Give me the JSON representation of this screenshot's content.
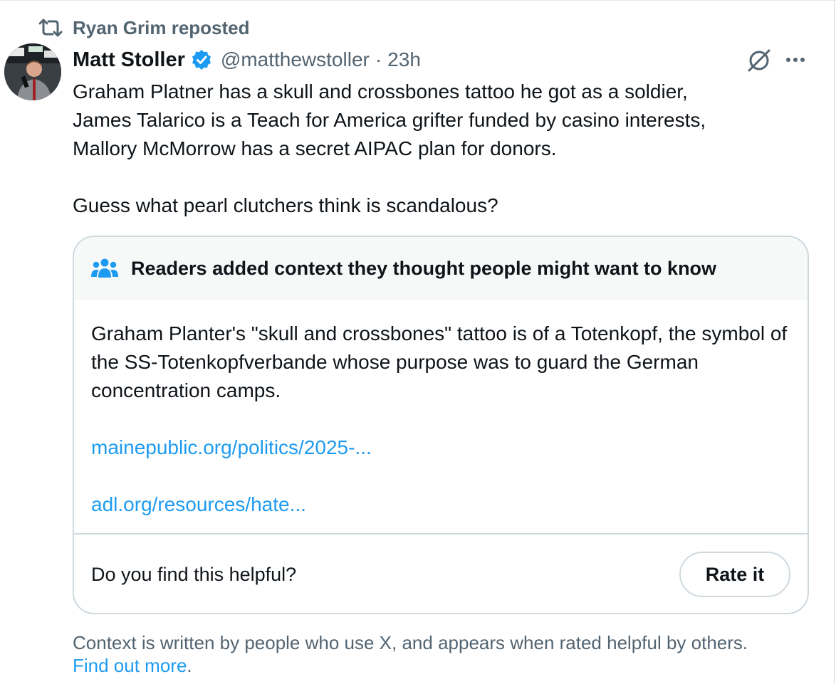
{
  "repost": {
    "text": "Ryan Grim reposted"
  },
  "author": {
    "name": "Matt Stoller",
    "handle": "@matthewstoller",
    "separator": "·",
    "time": "23h"
  },
  "tweet": {
    "lines": [
      "Graham Platner has a skull and crossbones tattoo he got as a soldier,",
      "James Talarico is a Teach for America grifter funded by casino interests,",
      "Mallory McMorrow has a secret AIPAC plan for donors."
    ],
    "last_line": "Guess what pearl clutchers think is scandalous?"
  },
  "community_note": {
    "header": "Readers added context they thought people might want to know",
    "body": "Graham Planter's \"skull and crossbones\" tattoo is of a Totenkopf, the symbol of the SS-Totenkopfverbande whose purpose was to guard the German concentration camps.",
    "links": [
      "mainepublic.org/politics/2025-...",
      "adl.org/resources/hate..."
    ],
    "question": "Do you find this helpful?",
    "rate_label": "Rate it"
  },
  "footer": {
    "text": "Context is written by people who use X, and appears when rated helpful by others.",
    "link": "Find out more",
    "period": "."
  },
  "colors": {
    "accent": "#1d9bf0",
    "secondary_text": "#536471",
    "border": "#cfd9de",
    "note_header_bg": "#f7f9f9"
  },
  "icons": [
    "repost-icon",
    "verified-badge-icon",
    "grok-icon",
    "more-icon",
    "community-icon"
  ]
}
